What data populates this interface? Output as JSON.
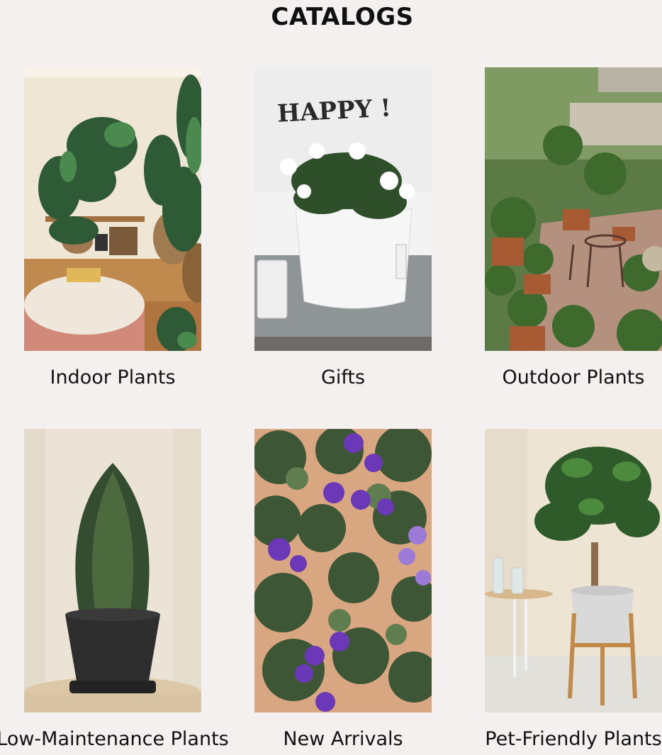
{
  "page": {
    "title": "CATALOGS"
  },
  "catalogs": [
    {
      "label": "Indoor Plants",
      "image": "indoor-living-room-plants"
    },
    {
      "label": "Gifts",
      "image": "white-flower-paper-bag-gift"
    },
    {
      "label": "Outdoor Plants",
      "image": "garden-patio-potted-shrubs"
    },
    {
      "label": "Low-Maintenance Plants",
      "image": "snake-plant-black-pot"
    },
    {
      "label": "New Arrivals",
      "image": "african-violets-purple"
    },
    {
      "label": "Pet-Friendly Plants",
      "image": "money-tree-on-stand"
    }
  ],
  "colors": {
    "background": "#f5f0f0",
    "text": "#111111"
  }
}
